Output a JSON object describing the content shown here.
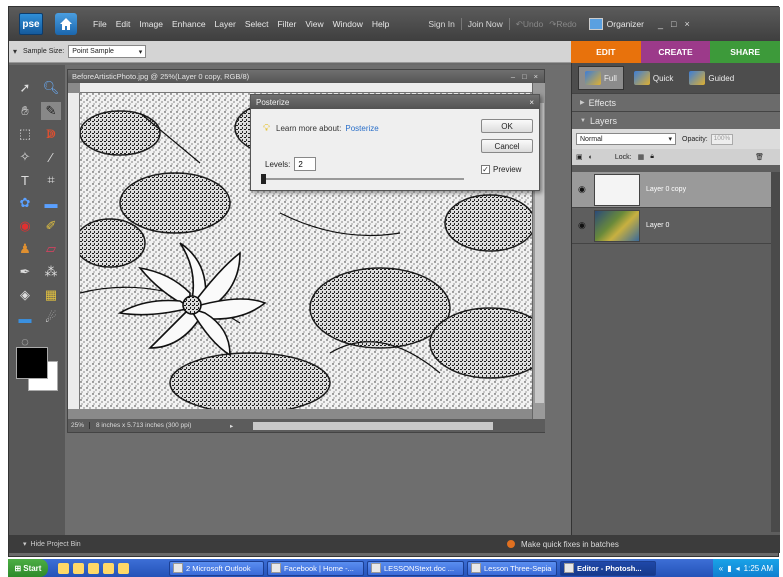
{
  "menubar": {
    "logo": "pse",
    "items": [
      "File",
      "Edit",
      "Image",
      "Enhance",
      "Layer",
      "Select",
      "Filter",
      "View",
      "Window",
      "Help"
    ],
    "sign_in": "Sign In",
    "join_now": "Join Now",
    "undo": "Undo",
    "redo": "Redo",
    "organizer": "Organizer",
    "minimize": "_",
    "maximize": "□",
    "close": "×"
  },
  "options_bar": {
    "sample_size_label": "Sample Size:",
    "sample_size_value": "Point Sample"
  },
  "mode_tabs": [
    {
      "label": "EDIT",
      "color": "#e8720c"
    },
    {
      "label": "CREATE",
      "color": "#9c3a8a"
    },
    {
      "label": "SHARE",
      "color": "#3d9a3a"
    }
  ],
  "document": {
    "title": "BeforeArtisticPhoto.jpg @ 25%(Layer 0 copy, RGB/8)",
    "zoom": "25%",
    "info": "8 inches x 5.713 inches (300 ppi)"
  },
  "dialog": {
    "title": "Posterize",
    "learn_more": "Learn more about:",
    "learn_link": "Posterize",
    "ok": "OK",
    "cancel": "Cancel",
    "levels_label": "Levels:",
    "levels_value": "2",
    "preview_label": "Preview",
    "preview_checked": true
  },
  "panel": {
    "subtabs": [
      "Full",
      "Quick",
      "Guided"
    ],
    "effects": "Effects",
    "layers": "Layers",
    "blend_mode": "Normal",
    "opacity_label": "Opacity:",
    "opacity_value": "100%",
    "lock_label": "Lock:",
    "layer_items": [
      "Layer 0 copy",
      "Layer 0"
    ]
  },
  "bin": {
    "hide_label": "Hide Project Bin",
    "quick_fix": "Make quick fixes in batches"
  },
  "taskbar": {
    "start": "Start",
    "buttons": [
      "2 Microsoft Outlook",
      "Facebook | Home -...",
      "LESSONStext.doc ...",
      "Lesson Three-Sepia",
      "Editor - Photosh..."
    ],
    "time": "1:25 AM"
  }
}
